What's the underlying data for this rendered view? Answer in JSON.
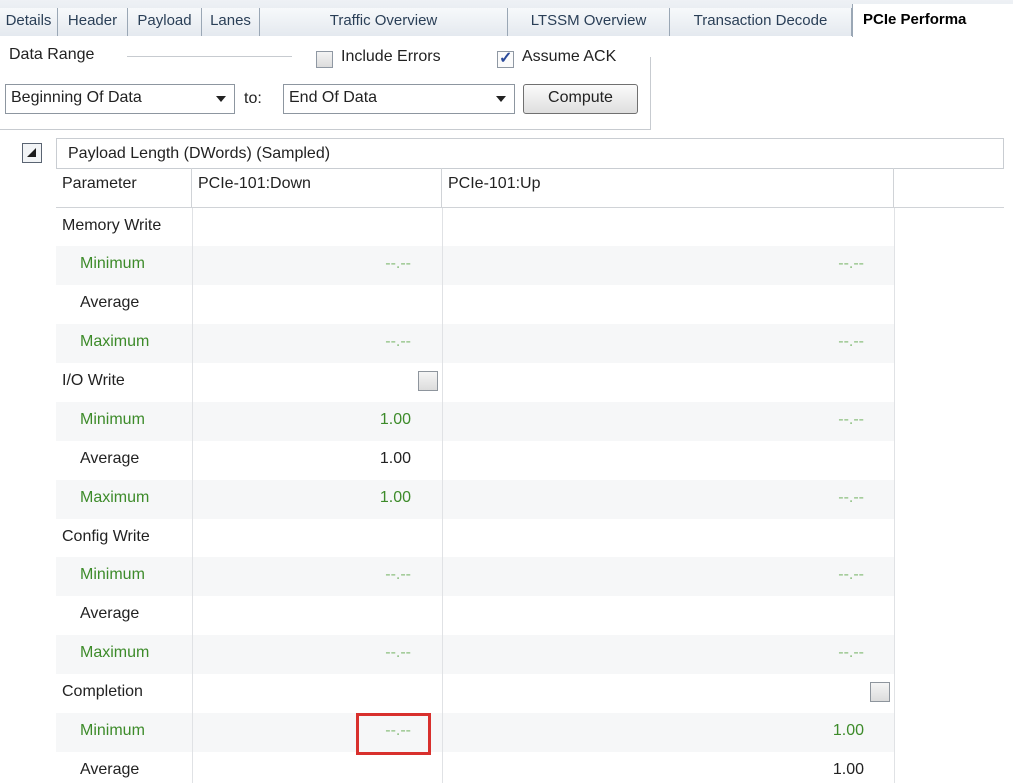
{
  "tabs": [
    "Details",
    "Header",
    "Payload",
    "Lanes",
    "Traffic Overview",
    "LTSSM Overview",
    "Transaction Decode",
    "PCIe Performa"
  ],
  "data_range": {
    "label": "Data Range",
    "include_errors": {
      "label": "Include Errors",
      "checked": false
    },
    "assume_ack": {
      "label": "Assume ACK",
      "checked": true
    },
    "from": "Beginning Of Data",
    "to_label": "to:",
    "to": "End Of Data",
    "compute_label": "Compute"
  },
  "grid": {
    "group_title": "Payload Length (DWords) (Sampled)",
    "columns": [
      "Parameter",
      "PCIe-101:Down",
      "PCIe-101:Up"
    ],
    "rows": [
      {
        "param": "Memory Write",
        "down": "",
        "up": ""
      },
      {
        "param": "Minimum",
        "down": "--.--",
        "up": "--.--"
      },
      {
        "param": "Average",
        "down": "",
        "up": ""
      },
      {
        "param": "Maximum",
        "down": "--.--",
        "up": "--.--"
      },
      {
        "param": "I/O Write",
        "down": "",
        "up": ""
      },
      {
        "param": "Minimum",
        "down": "1.00",
        "up": "--.--"
      },
      {
        "param": "Average",
        "down": "1.00",
        "up": ""
      },
      {
        "param": "Maximum",
        "down": "1.00",
        "up": "--.--"
      },
      {
        "param": "Config Write",
        "down": "",
        "up": ""
      },
      {
        "param": "Minimum",
        "down": "--.--",
        "up": "--.--"
      },
      {
        "param": "Average",
        "down": "",
        "up": ""
      },
      {
        "param": "Maximum",
        "down": "--.--",
        "up": "--.--"
      },
      {
        "param": "Completion",
        "down": "",
        "up": ""
      },
      {
        "param": "Minimum",
        "down": "--.--",
        "up": "1.00"
      },
      {
        "param": "Average",
        "down": "",
        "up": "1.00"
      }
    ]
  },
  "colors": {
    "stat_green": "#3d8b2a",
    "highlight_red": "#d8302d"
  }
}
